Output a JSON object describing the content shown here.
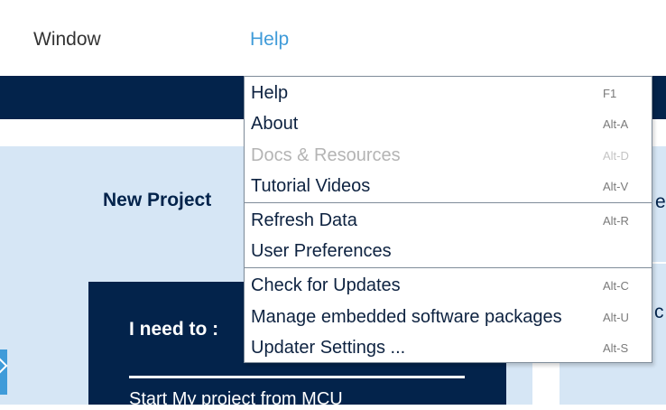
{
  "menubar": {
    "window_label": "Window",
    "help_label": "Help"
  },
  "background": {
    "new_project_label": "New Project",
    "right_text_top": "e",
    "right_text_mid": "c",
    "card_title": "I need to :",
    "card_link": "Start My project from MCU"
  },
  "help_menu": {
    "items": [
      {
        "label": "Help",
        "shortcut": "F1",
        "enabled": true
      },
      {
        "label": "About",
        "shortcut": "Alt-A",
        "enabled": true
      },
      {
        "label": "Docs & Resources",
        "shortcut": "Alt-D",
        "enabled": false
      },
      {
        "label": "Tutorial Videos",
        "shortcut": "Alt-V",
        "enabled": true
      },
      {
        "label": "Refresh Data",
        "shortcut": "Alt-R",
        "enabled": true
      },
      {
        "label": "User Preferences",
        "shortcut": "",
        "enabled": true
      },
      {
        "label": "Check for Updates",
        "shortcut": "Alt-C",
        "enabled": true
      },
      {
        "label": "Manage embedded software packages",
        "shortcut": "Alt-U",
        "enabled": true
      },
      {
        "label": "Updater Settings ...",
        "shortcut": "Alt-S",
        "enabled": true
      }
    ]
  },
  "colors": {
    "accent": "#3f9bd9",
    "navy": "#03234b",
    "panel": "#d6e6f5"
  }
}
